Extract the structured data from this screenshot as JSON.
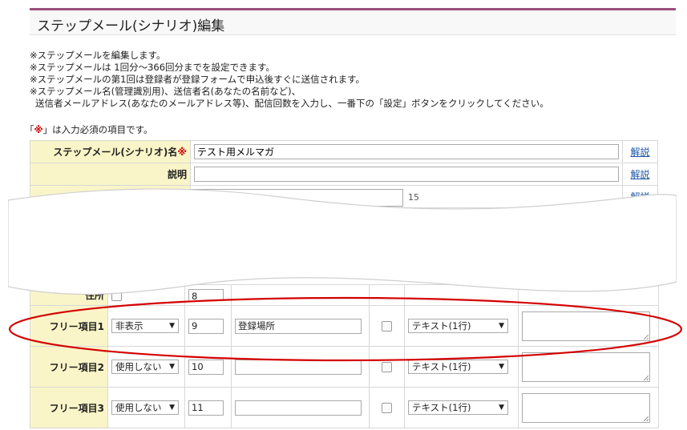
{
  "page": {
    "title": "ステップメール(シナリオ)編集"
  },
  "notes": [
    "※ステップメールを編集します。",
    "※ステップメールは 1回分～366回分までを設定できます。",
    "※ステップメールの第1回は登録者が登録フォームで申込後すぐに送信されます。",
    "※ステップメール名(管理識別用)、送信者名(あなたの名前など)、",
    "送信者メールアドレス(あなたのメールアドレス等)、配信回数を入力し、一番下の「設定」ボタンをクリックしてください。"
  ],
  "required_note": {
    "open": "「",
    "mark": "※",
    "text": "」は入力必須の項目です。"
  },
  "form": {
    "scenario_name": {
      "label": "ステップメール(シナリオ)名",
      "required_mark": "※",
      "value": "テスト用メルマガ",
      "help": "解説"
    },
    "description": {
      "label": "説明",
      "value": "",
      "help": "解説"
    },
    "third_row_help": "解説",
    "partial_value": "15"
  },
  "fields": [
    {
      "label": "住所",
      "display": "",
      "order": "8",
      "name": "",
      "type": "",
      "partial": true
    },
    {
      "label": "フリー項目1",
      "display": "非表示",
      "order": "9",
      "name": "登録場所",
      "type": "テキスト(1行)"
    },
    {
      "label": "フリー項目2",
      "display": "使用しない",
      "order": "10",
      "name": "",
      "type": "テキスト(1行)"
    },
    {
      "label": "フリー項目3",
      "display": "使用しない",
      "order": "11",
      "name": "",
      "type": "テキスト(1行)"
    }
  ],
  "colors": {
    "accent": "#9b4f7e",
    "label_bg": "#faf5c8",
    "annotation": "#d40000",
    "link": "#1d55a7"
  }
}
